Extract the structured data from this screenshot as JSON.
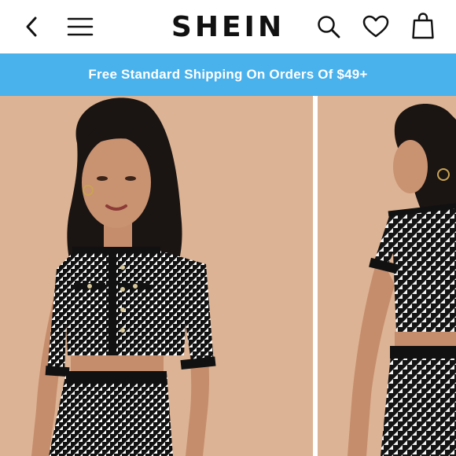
{
  "header": {
    "logo_text": "SHEIN",
    "icons": [
      "chevron-left-icon",
      "menu-icon",
      "search-icon",
      "heart-icon",
      "shopping-bag-icon"
    ]
  },
  "promo_banner": {
    "text": "Free Standard Shipping On Orders Of $49+"
  },
  "gallery": {
    "images": [
      {
        "name": "product-image-front",
        "subject": "model wearing houndstooth crop top and skirt set, front view"
      },
      {
        "name": "product-image-back",
        "subject": "model wearing houndstooth crop top and skirt set, back view"
      }
    ]
  },
  "colors": {
    "banner": "#49b1ec",
    "photo_background": "#dcb394",
    "text_dark": "#111111"
  }
}
